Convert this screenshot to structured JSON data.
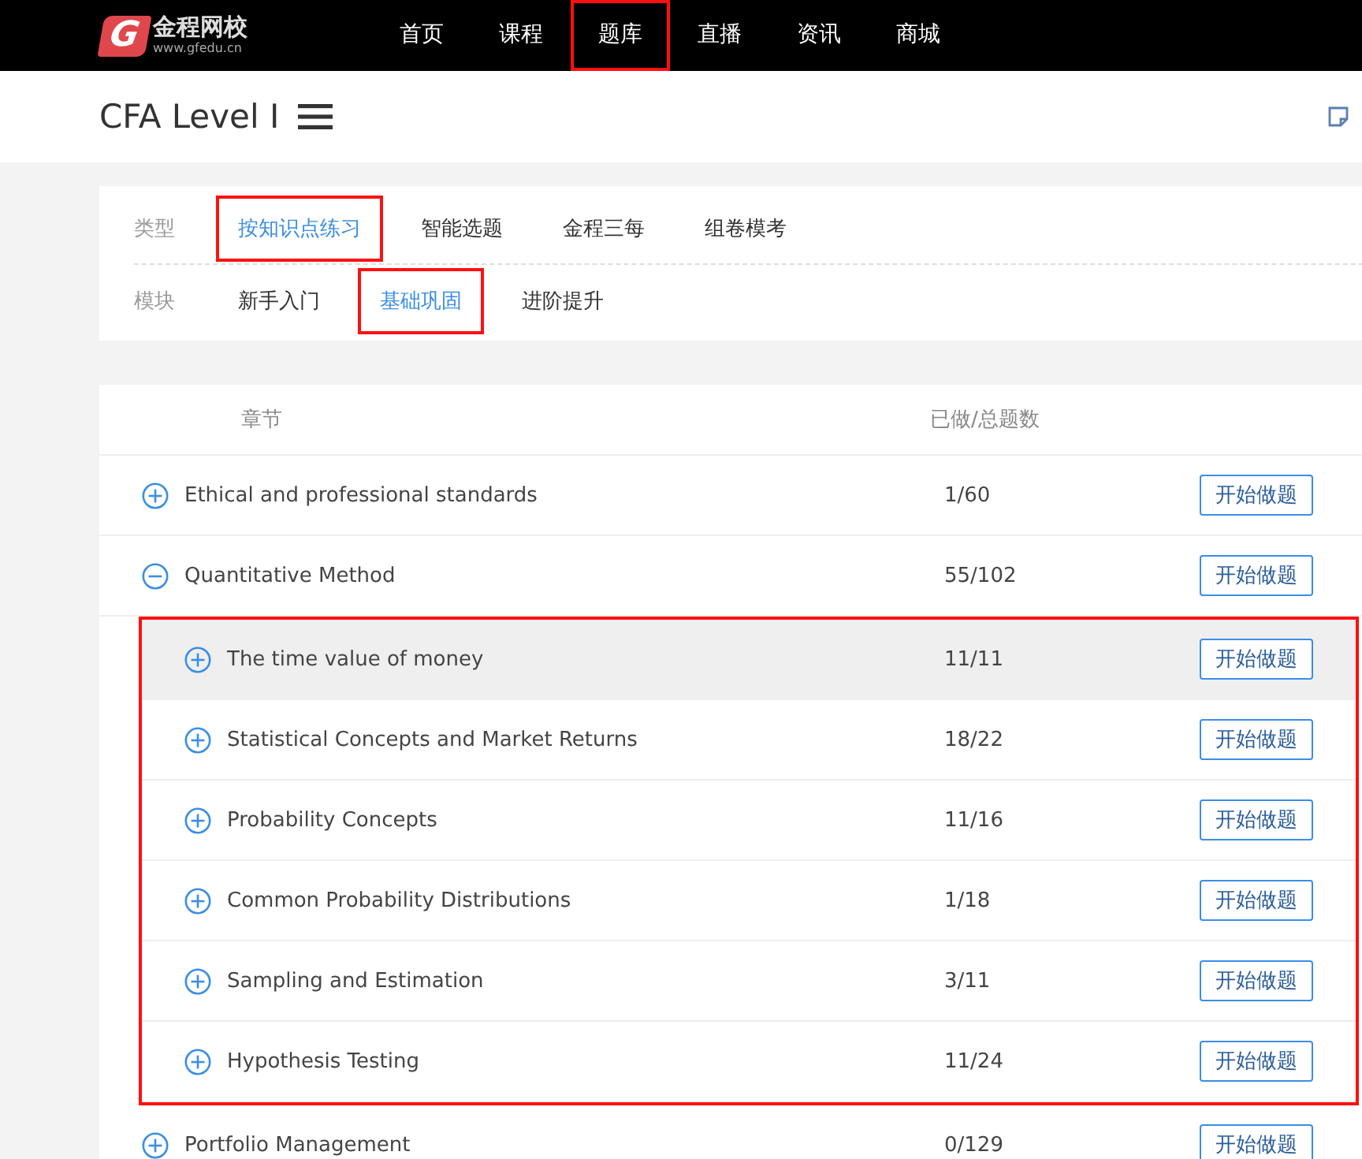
{
  "site": {
    "logo_mark": "G",
    "logo_name": "金程网校",
    "logo_url": "www.gfedu.cn"
  },
  "nav": [
    {
      "label": "首页",
      "annotated": false
    },
    {
      "label": "课程",
      "annotated": false
    },
    {
      "label": "题库",
      "annotated": true
    },
    {
      "label": "直播",
      "annotated": false
    },
    {
      "label": "资讯",
      "annotated": false
    },
    {
      "label": "商城",
      "annotated": false
    }
  ],
  "page_title": "CFA Level I",
  "filters": [
    {
      "label": "类型",
      "options": [
        {
          "label": "按知识点练习",
          "selected": true,
          "annotated": true
        },
        {
          "label": "智能选题",
          "selected": false,
          "annotated": false
        },
        {
          "label": "金程三每",
          "selected": false,
          "annotated": false
        },
        {
          "label": "组卷模考",
          "selected": false,
          "annotated": false
        }
      ]
    },
    {
      "label": "模块",
      "options": [
        {
          "label": "新手入门",
          "selected": false,
          "annotated": false
        },
        {
          "label": "基础巩固",
          "selected": true,
          "annotated": true
        },
        {
          "label": "进阶提升",
          "selected": false,
          "annotated": false
        }
      ]
    }
  ],
  "table": {
    "columns": [
      "章节",
      "已做/总题数"
    ],
    "rows": [
      {
        "title": "Ethical and professional standards",
        "progress": "1/60",
        "button": "开始做题",
        "expanded": false
      },
      {
        "title": "Quantitative Method",
        "progress": "55/102",
        "button": "开始做题",
        "expanded": true,
        "children_annotated": true,
        "children": [
          {
            "title": "The time value of money",
            "progress": "11/11",
            "button": "开始做题",
            "expanded": false,
            "hovered": true
          },
          {
            "title": "Statistical Concepts and Market Returns",
            "progress": "18/22",
            "button": "开始做题",
            "expanded": false,
            "hovered": false
          },
          {
            "title": "Probability Concepts",
            "progress": "11/16",
            "button": "开始做题",
            "expanded": false,
            "hovered": false
          },
          {
            "title": "Common Probability Distributions",
            "progress": "1/18",
            "button": "开始做题",
            "expanded": false,
            "hovered": false
          },
          {
            "title": "Sampling and Estimation",
            "progress": "3/11",
            "button": "开始做题",
            "expanded": false,
            "hovered": false
          },
          {
            "title": "Hypothesis Testing",
            "progress": "11/24",
            "button": "开始做题",
            "expanded": false,
            "hovered": false
          }
        ]
      },
      {
        "title": "Portfolio Management",
        "progress": "0/129",
        "button": "开始做题",
        "expanded": false
      }
    ]
  }
}
